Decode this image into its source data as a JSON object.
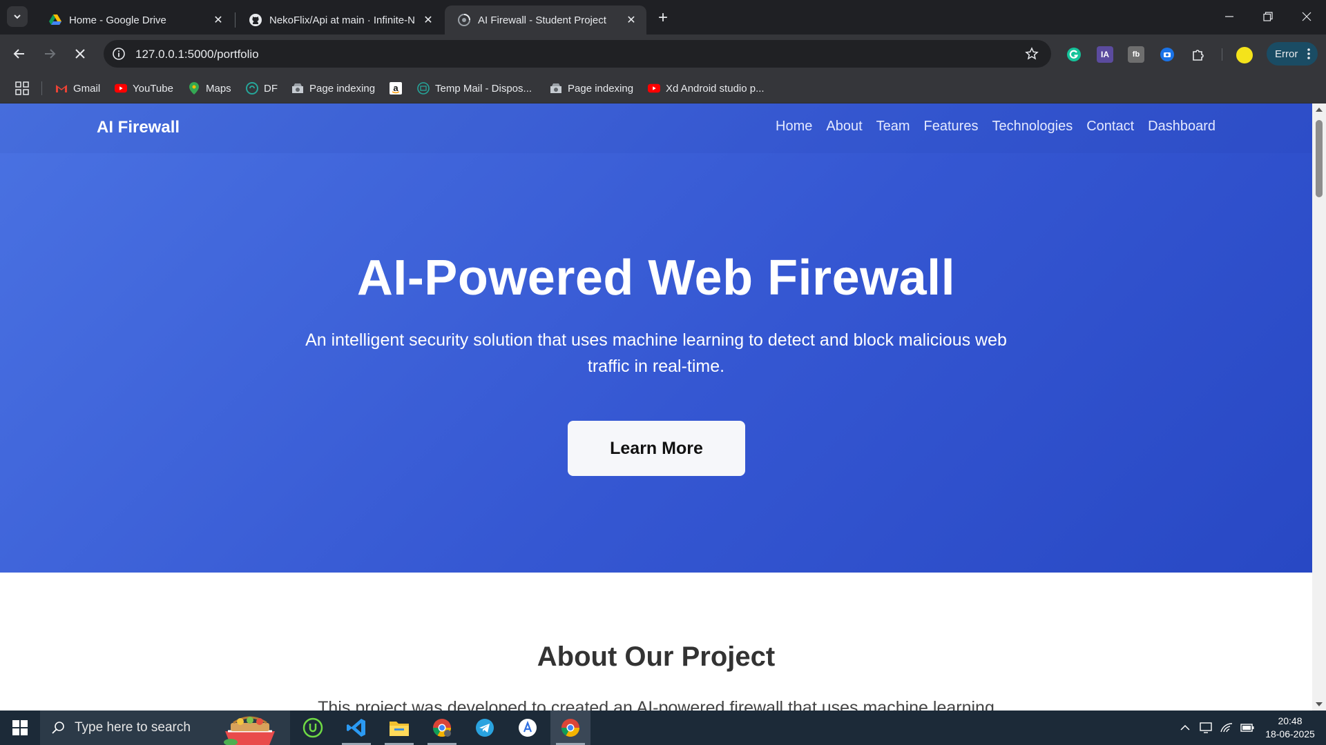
{
  "browser": {
    "tabs": [
      {
        "title": "Home - Google Drive",
        "icon": "google-drive-icon",
        "active": false
      },
      {
        "title": "NekoFlix/Api at main · Infinite-N",
        "icon": "github-icon",
        "active": false
      },
      {
        "title": "AI Firewall - Student Project",
        "icon": "loading-globe-icon",
        "active": true
      }
    ],
    "address": {
      "url": "127.0.0.1:5000/portfolio"
    },
    "extensions": {
      "ia_label": "IA",
      "error_label": "Error"
    },
    "bookmarks": [
      {
        "label": "Gmail",
        "icon": "gmail-icon"
      },
      {
        "label": "YouTube",
        "icon": "youtube-icon"
      },
      {
        "label": "Maps",
        "icon": "maps-icon"
      },
      {
        "label": "DF",
        "icon": "df-icon"
      },
      {
        "label": "Page indexing",
        "icon": "search-console-icon"
      },
      {
        "label": "",
        "icon": "amazon-icon"
      },
      {
        "label": "Temp Mail - Dispos...",
        "icon": "tempmail-icon"
      },
      {
        "label": "Page indexing",
        "icon": "search-console-icon"
      },
      {
        "label": "Xd Android studio p...",
        "icon": "youtube-icon"
      }
    ]
  },
  "site": {
    "brand": "AI Firewall",
    "nav": [
      "Home",
      "About",
      "Team",
      "Features",
      "Technologies",
      "Contact",
      "Dashboard"
    ],
    "hero": {
      "title": "AI-Powered Web Firewall",
      "subtitle": "An intelligent security solution that uses machine learning to detect and block malicious web traffic in real-time.",
      "cta": "Learn More"
    },
    "about": {
      "title": "About Our Project",
      "text": "This project was developed to created an AI-powered firewall that uses machine learning"
    },
    "colors": {
      "hero_start": "#4a72e2",
      "hero_end": "#2848c4",
      "cta_bg": "#f6f7fa"
    }
  },
  "taskbar": {
    "search_placeholder": "Type here to search",
    "apps": [
      "upwork-icon",
      "vscode-icon",
      "file-explorer-icon",
      "chrome-profile-icon",
      "telegram-icon",
      "app-store-icon",
      "chrome-icon"
    ],
    "time": "20:48",
    "date": "18-06-2025"
  }
}
